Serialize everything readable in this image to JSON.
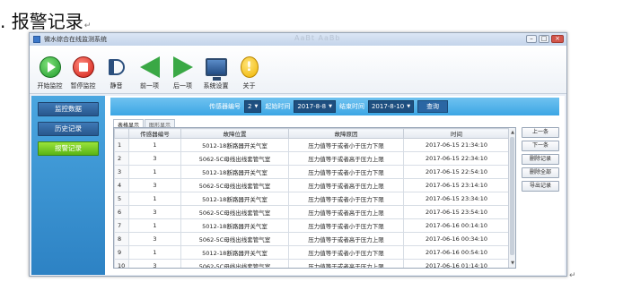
{
  "doc": {
    "heading": ". 报警记录",
    "para_mark": "↵",
    "end_mark": "↵"
  },
  "window": {
    "title": "微水综合在线监测系统",
    "watermark": "AaBt AaBb",
    "controls": [
      "–",
      "□",
      "×"
    ]
  },
  "toolbar": [
    {
      "label": "开始监控",
      "icon": "play-circle-icon"
    },
    {
      "label": "暂停监控",
      "icon": "stop-circle-icon"
    },
    {
      "label": "静音",
      "icon": "speaker-mute-icon"
    },
    {
      "label": "前一项",
      "icon": "arrow-left-icon"
    },
    {
      "label": "后一项",
      "icon": "arrow-right-icon"
    },
    {
      "label": "系统设置",
      "icon": "monitor-icon"
    },
    {
      "label": "关于",
      "icon": "info-icon"
    }
  ],
  "sidebar": {
    "items": [
      "监控数据",
      "历史记录",
      "报警记录"
    ],
    "active_index": 2
  },
  "filter": {
    "sensor_label": "传感器编号",
    "sensor_value": "2",
    "start_label": "起始时间",
    "start_value": "2017-8-8",
    "end_label": "结束时间",
    "end_value": "2017-8-10",
    "query_label": "查询"
  },
  "tabs": [
    "表格显示",
    "图形显示"
  ],
  "table": {
    "columns": [
      "",
      "传感器编号",
      "故障位置",
      "故障原因",
      "时间"
    ],
    "rows": [
      [
        "1",
        "1",
        "5012-18断路器开关气室",
        "压力值等于或者小于压力下限",
        "2017-06-15 21:34:10"
      ],
      [
        "2",
        "3",
        "5062-5C母线出线套管气室",
        "压力值等于或者高于压力上限",
        "2017-06-15 22:34:10"
      ],
      [
        "3",
        "1",
        "5012-18断路器开关气室",
        "压力值等于或者小于压力下限",
        "2017-06-15 22:54:10"
      ],
      [
        "4",
        "3",
        "5062-5C母线出线套管气室",
        "压力值等于或者高于压力上限",
        "2017-06-15 23:14:10"
      ],
      [
        "5",
        "1",
        "5012-18断路器开关气室",
        "压力值等于或者小于压力下限",
        "2017-06-15 23:34:10"
      ],
      [
        "6",
        "3",
        "5062-5C母线出线套管气室",
        "压力值等于或者高于压力上限",
        "2017-06-15 23:54:10"
      ],
      [
        "7",
        "1",
        "5012-18断路器开关气室",
        "压力值等于或者小于压力下限",
        "2017-06-16 00:14:10"
      ],
      [
        "8",
        "3",
        "5062-5C母线出线套管气室",
        "压力值等于或者高于压力上限",
        "2017-06-16 00:34:10"
      ],
      [
        "9",
        "1",
        "5012-18断路器开关气室",
        "压力值等于或者小于压力下限",
        "2017-06-16 00:54:10"
      ],
      [
        "10",
        "3",
        "5062-5C母线出线套管气室",
        "压力值等于或者高于压力上限",
        "2017-06-16 01:14:10"
      ]
    ]
  },
  "side_buttons": [
    "上一条",
    "下一条",
    "删除记录",
    "删除全部",
    "导出记录"
  ]
}
